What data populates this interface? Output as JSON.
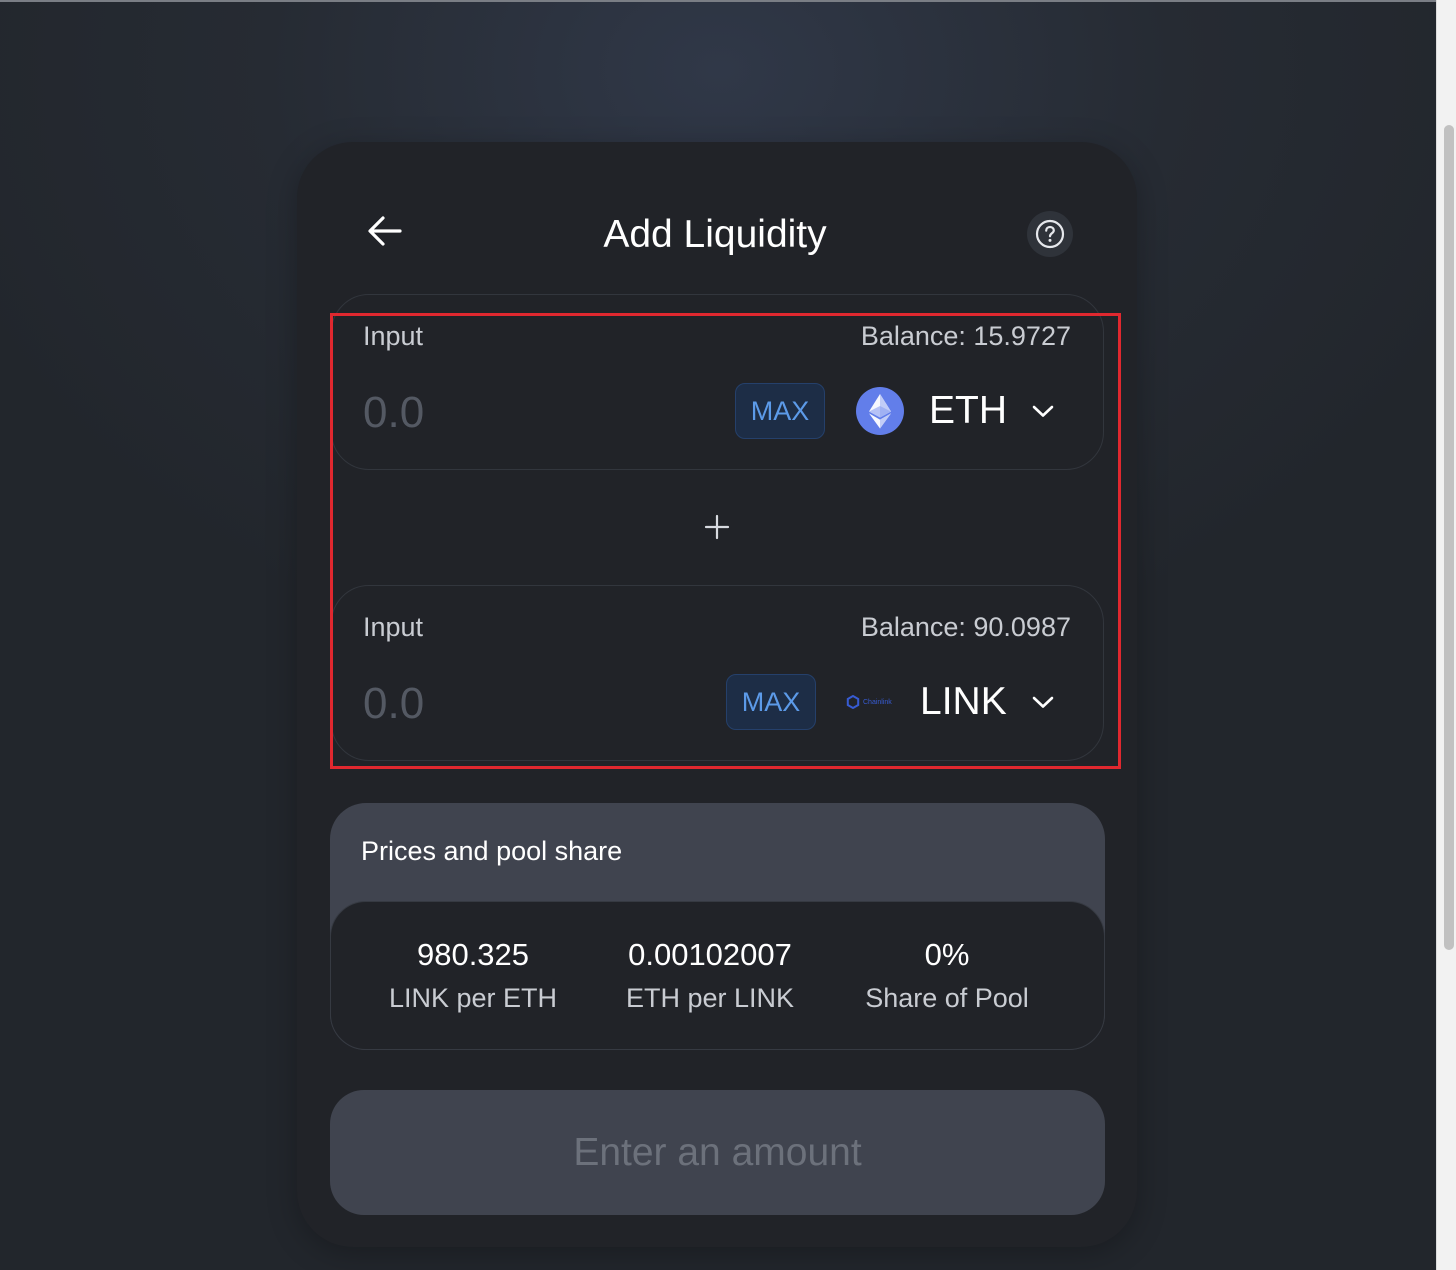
{
  "header": {
    "title": "Add Liquidity"
  },
  "inputs": [
    {
      "label": "Input",
      "balance": "Balance: 15.9727",
      "placeholder": "0.0",
      "max_label": "MAX",
      "token": {
        "symbol": "ETH",
        "icon": "eth-logo-icon",
        "color": "#627eea"
      }
    },
    {
      "label": "Input",
      "balance": "Balance: 90.0987",
      "placeholder": "0.0",
      "max_label": "MAX",
      "token": {
        "symbol": "LINK",
        "icon": "chainlink-logo-icon",
        "logo_text": "Chainlink",
        "color": "#375bd2"
      }
    }
  ],
  "prices": {
    "title": "Prices and pool share",
    "stats": [
      {
        "value": "980.325",
        "label": "LINK per ETH"
      },
      {
        "value": "0.00102007",
        "label": "ETH per LINK"
      },
      {
        "value": "0%",
        "label": "Share of Pool"
      }
    ]
  },
  "submit": {
    "label": "Enter an amount"
  },
  "colors": {
    "accent": "#5c9ae8",
    "highlight": "#e0282f",
    "card_bg": "#212328"
  }
}
